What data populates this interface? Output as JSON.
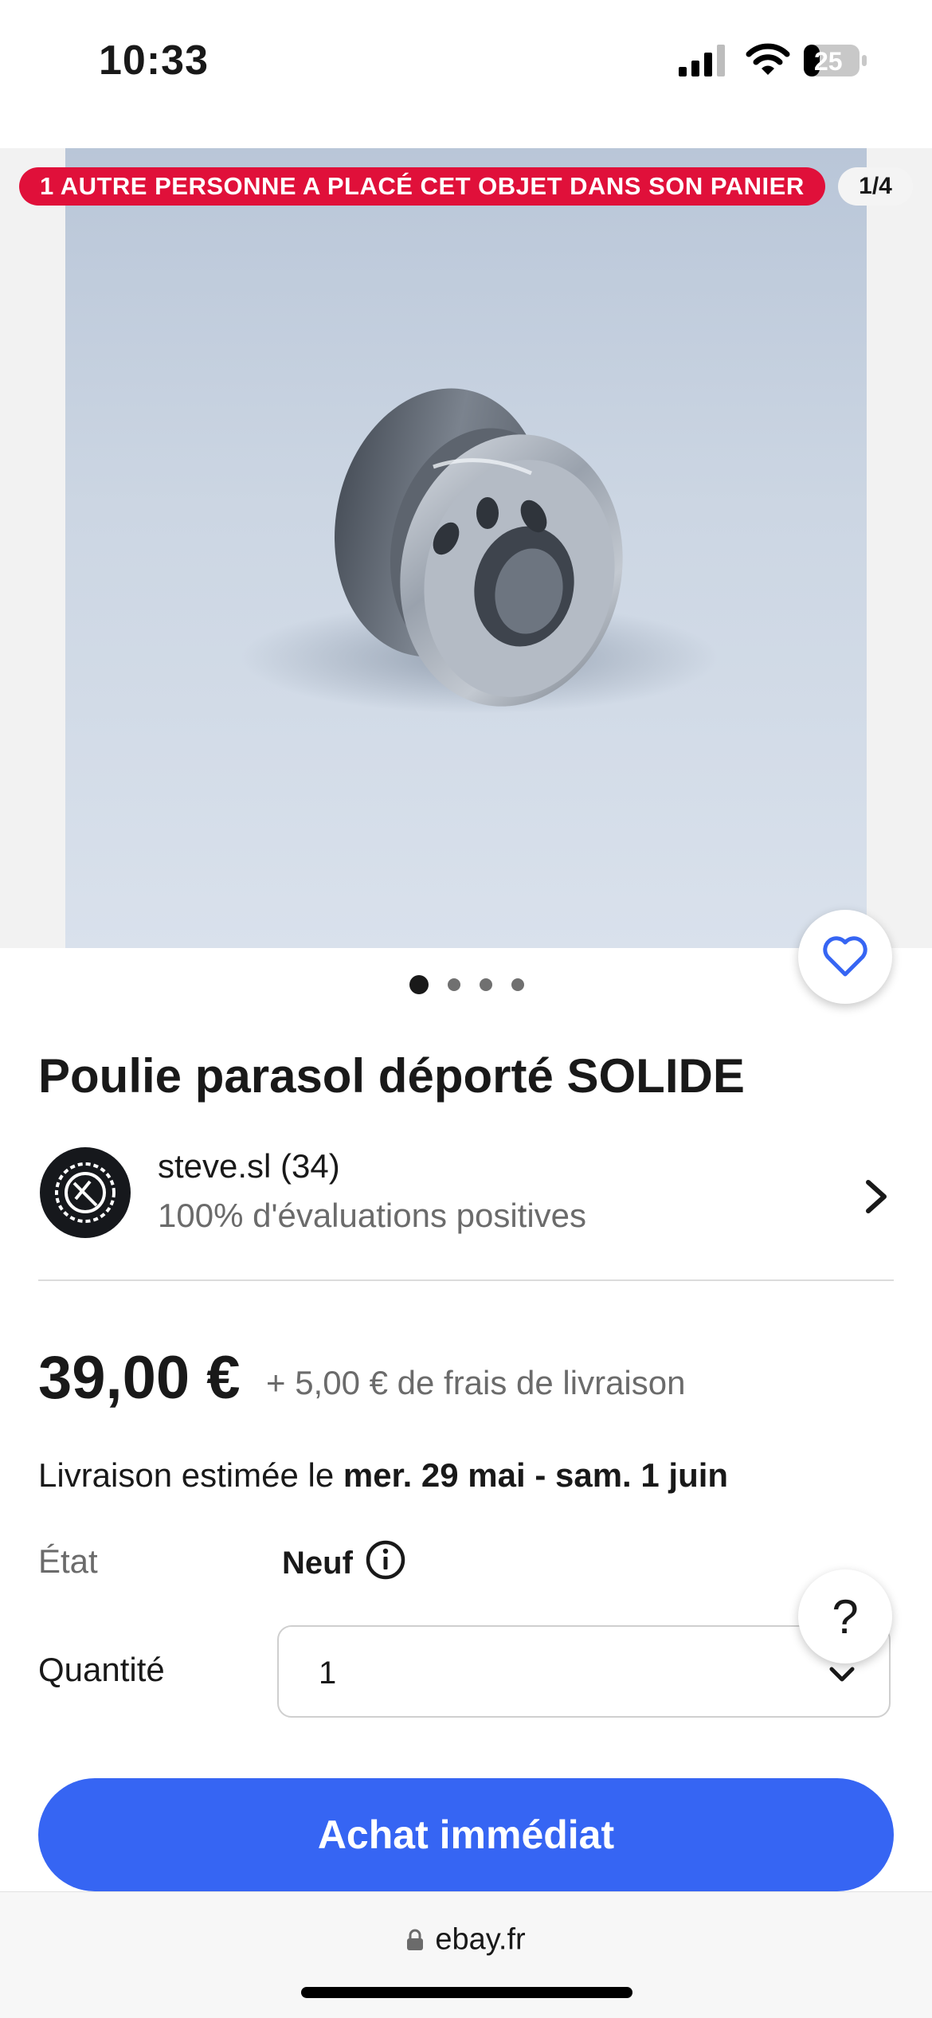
{
  "status_bar": {
    "time": "10:33",
    "battery": "25"
  },
  "gallery": {
    "cart_badge": "1 AUTRE PERSONNE A PLACÉ CET OBJET DANS SON PANIER",
    "counter": "1/4",
    "image_count": 4,
    "active_index": 0
  },
  "product": {
    "title": "Poulie parasol déporté SOLIDE"
  },
  "seller": {
    "name": "steve.sl (34)",
    "rating": "100% d'évaluations positives"
  },
  "pricing": {
    "price": "39,00 €",
    "shipping": "+ 5,00 € de frais de livraison",
    "delivery_prefix": "Livraison estimée le ",
    "delivery_dates": "mer. 29 mai - sam. 1 juin"
  },
  "condition": {
    "label": "État",
    "value": "Neuf"
  },
  "quantity": {
    "label": "Quantité",
    "value": "1"
  },
  "help": {
    "label": "?"
  },
  "actions": {
    "buy_now": "Achat immédiat"
  },
  "browser": {
    "url": "ebay.fr"
  },
  "colors": {
    "accent": "#3665f3",
    "badge": "#e0103a"
  },
  "icons": [
    "signal-icon",
    "wifi-icon",
    "battery-icon",
    "heart-icon",
    "chevron-right-icon",
    "info-icon",
    "chevron-down-icon",
    "lock-icon"
  ]
}
